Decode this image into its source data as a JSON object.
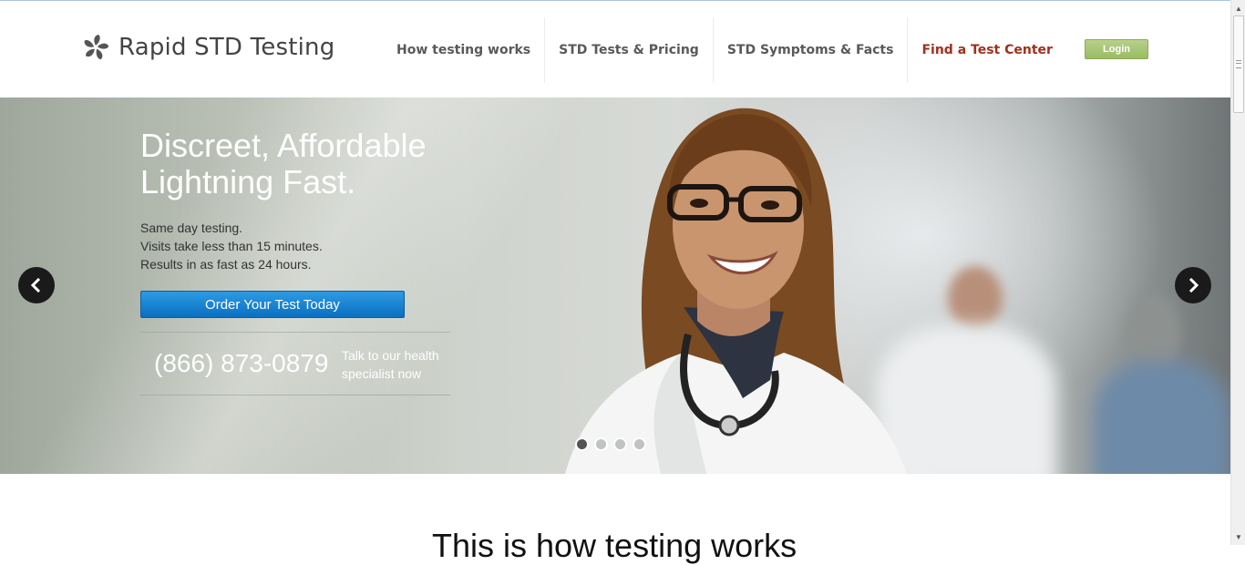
{
  "header": {
    "logo_text": "Rapid STD Testing",
    "nav": [
      {
        "label": "How testing works"
      },
      {
        "label": "STD Tests & Pricing"
      },
      {
        "label": "STD Symptoms & Facts"
      },
      {
        "label": "Find a Test Center"
      }
    ],
    "login_label": "Login"
  },
  "hero": {
    "title_line1": "Discreet, Affordable",
    "title_line2": "Lightning Fast.",
    "lines": [
      "Same day testing.",
      "Visits take less than 15 minutes.",
      "Results in as fast as 24 hours."
    ],
    "cta_label": "Order Your Test Today",
    "phone": "(866) 873-0879",
    "phone_note_line1": "Talk to our health",
    "phone_note_line2": "specialist now",
    "slide_count": 4,
    "active_slide": 1
  },
  "section": {
    "title": "This is how testing works"
  },
  "colors": {
    "accent_red": "#a0301a",
    "login_green": "#9bbb63",
    "cta_blue": "#1a85d6"
  },
  "icons": [
    "logo-pinwheel-icon",
    "chevron-left-icon",
    "chevron-right-icon"
  ]
}
